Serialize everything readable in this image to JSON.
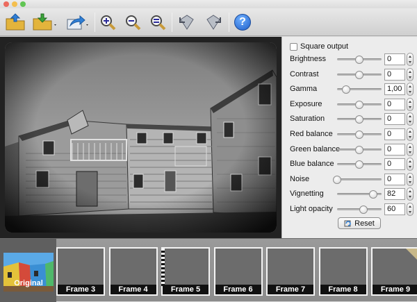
{
  "window": {
    "light_colors": [
      "#ec6a5e",
      "#f4bf4f",
      "#61c554"
    ]
  },
  "toolbar": {
    "icons": [
      "open-folder-icon",
      "save-icon",
      "share-icon",
      "zoom-in-icon",
      "zoom-out-icon",
      "zoom-fit-icon",
      "rotate-left-icon",
      "rotate-right-icon",
      "help-icon"
    ],
    "help_label": "?"
  },
  "panel": {
    "square_output_label": "Square output",
    "square_output_checked": false,
    "sliders": [
      {
        "label": "Brightness",
        "value": "0",
        "fraction": 0.5
      },
      {
        "label": "Contrast",
        "value": "0",
        "fraction": 0.5
      },
      {
        "label": "Gamma",
        "value": "1,00",
        "fraction": 0.21
      },
      {
        "label": "Exposure",
        "value": "0",
        "fraction": 0.5
      },
      {
        "label": "Saturation",
        "value": "0",
        "fraction": 0.5
      },
      {
        "label": "Red balance",
        "value": "0",
        "fraction": 0.5
      },
      {
        "label": "Green balance",
        "value": "0",
        "fraction": 0.5
      },
      {
        "label": "Blue balance",
        "value": "0",
        "fraction": 0.5
      },
      {
        "label": "Noise",
        "value": "0",
        "fraction": 0.0
      },
      {
        "label": "Vignetting",
        "value": "82",
        "fraction": 0.82
      },
      {
        "label": "Light opacity",
        "value": "60",
        "fraction": 0.6
      }
    ],
    "reset_label": "Reset"
  },
  "frames": [
    {
      "label": "Original"
    },
    {
      "label": "Frame 3"
    },
    {
      "label": "Frame 4"
    },
    {
      "label": "Frame 5"
    },
    {
      "label": "Frame 6"
    },
    {
      "label": "Frame 7"
    },
    {
      "label": "Frame 8"
    },
    {
      "label": "Frame 9"
    }
  ]
}
